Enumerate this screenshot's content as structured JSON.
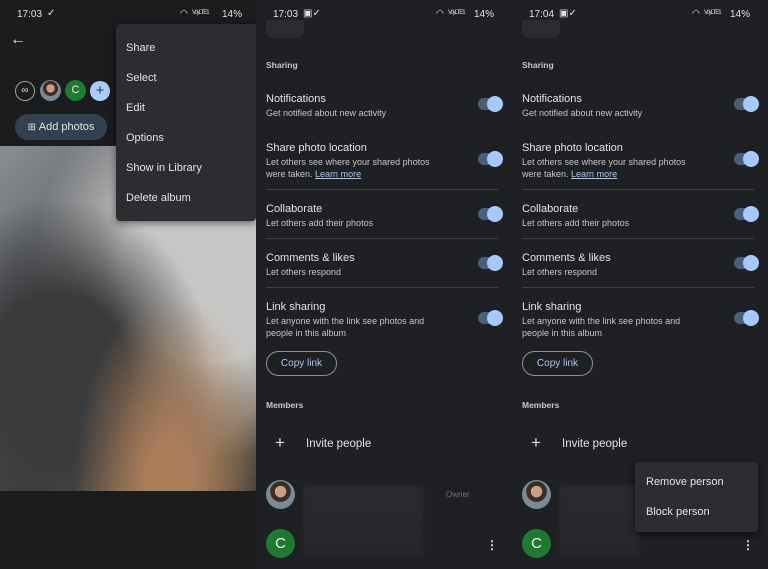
{
  "panel1": {
    "status": {
      "time": "17:03",
      "battery": "14%",
      "signal": "Vo) LTE1"
    },
    "add_photos_label": "Add photos",
    "avatar_letter": "C",
    "menu": [
      "Share",
      "Select",
      "Edit",
      "Options",
      "Show in Library",
      "Delete album"
    ]
  },
  "panel2": {
    "status": {
      "time": "17:03",
      "battery": "14%",
      "signal": "Vo) LTE1"
    }
  },
  "panel3": {
    "status": {
      "time": "17:04",
      "battery": "14%",
      "signal": "Vo) LTE1"
    },
    "person_menu": [
      "Remove person",
      "Block person"
    ]
  },
  "settings": {
    "sharing_title": "Sharing",
    "items": [
      {
        "title": "Notifications",
        "subtitle": "Get notified about new activity",
        "enabled": true
      },
      {
        "title": "Share photo location",
        "subtitle": "Let others see where your shared photos were taken.",
        "link": "Learn more",
        "enabled": true
      },
      {
        "title": "Collaborate",
        "subtitle": "Let others add their photos",
        "enabled": true
      },
      {
        "title": "Comments & likes",
        "subtitle": "Let others respond",
        "enabled": true
      },
      {
        "title": "Link sharing",
        "subtitle": "Let anyone with the link see photos and people in this album",
        "enabled": true
      }
    ],
    "copy_link": "Copy link",
    "members_title": "Members",
    "invite_label": "Invite people",
    "owner_label": "Owner",
    "member_letter": "C"
  },
  "colors": {
    "accent": "#a8c7fa",
    "background": "#1f2023",
    "avatar_green": "#1e7a2e"
  }
}
